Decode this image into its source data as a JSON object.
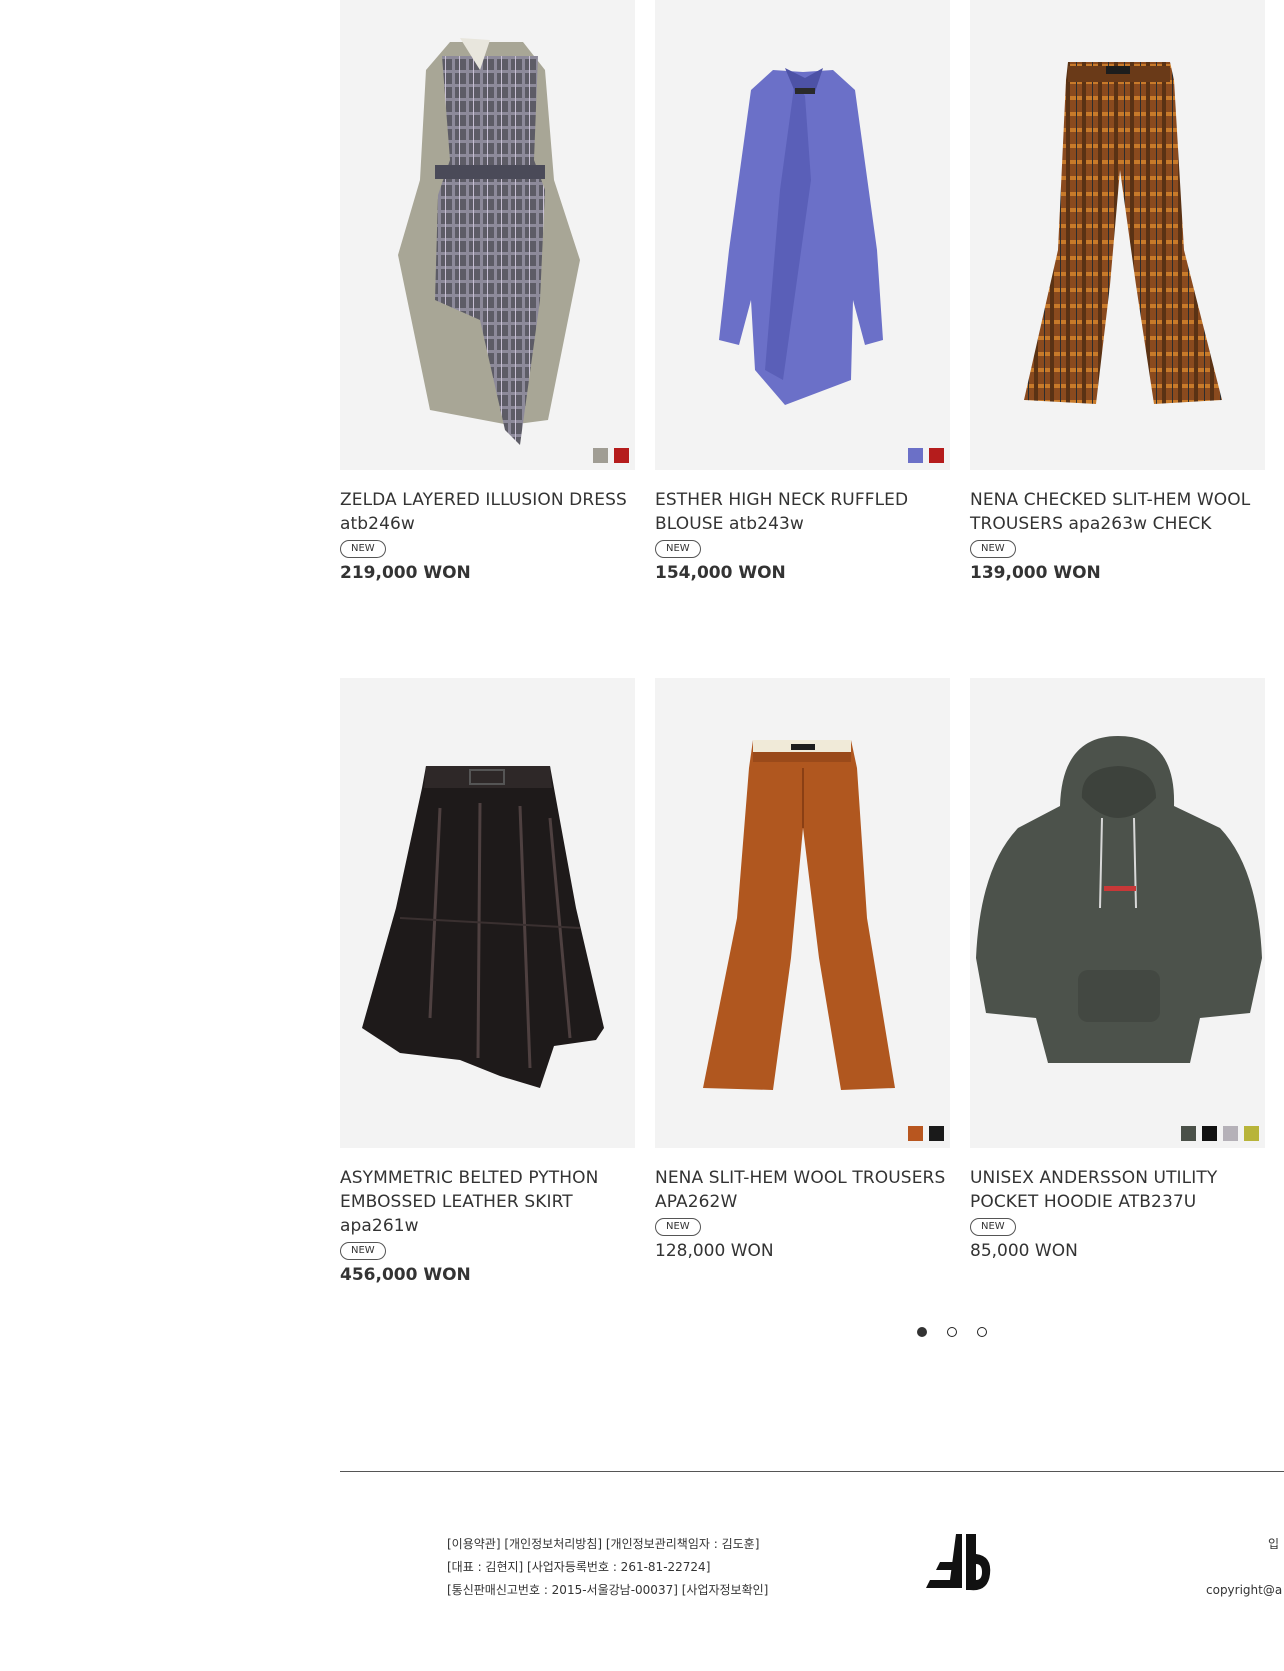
{
  "products": [
    {
      "title": "ZELDA LAYERED ILLUSION DRESS atb246w",
      "badge": "NEW",
      "price": "219,000 WON",
      "price_bold": true,
      "image_icon": "dress-image",
      "swatches": [
        "#a09d94",
        "#b51c1c"
      ]
    },
    {
      "title": "ESTHER HIGH NECK RUFFLED BLOUSE atb243w",
      "badge": "NEW",
      "price": "154,000 WON",
      "price_bold": true,
      "image_icon": "blouse-image",
      "swatches": [
        "#6b70c7",
        "#b51c1c"
      ]
    },
    {
      "title": "NENA CHECKED SLIT-HEM WOOL TROUSERS apa263w CHECK",
      "badge": "NEW",
      "price": "139,000 WON",
      "price_bold": true,
      "image_icon": "trousers-image",
      "swatches": []
    },
    {
      "title": "ASYMMETRIC BELTED PYTHON EMBOSSED LEATHER SKIRT apa261w",
      "badge": "NEW",
      "price": "456,000 WON",
      "price_bold": true,
      "image_icon": "skirt-image",
      "swatches": []
    },
    {
      "title": "NENA SLIT-HEM WOOL TROUSERS APA262W",
      "badge": "NEW",
      "price": "128,000 WON",
      "price_bold": false,
      "image_icon": "trousers-image",
      "swatches": [
        "#b8561f",
        "#1a1a1a"
      ]
    },
    {
      "title": "UNISEX ANDERSSON UTILITY POCKET HOODIE ATB237U",
      "badge": "NEW",
      "price": "85,000 WON",
      "price_bold": false,
      "image_icon": "hoodie-image",
      "swatches": [
        "#4a5048",
        "#111111",
        "#b5b1b8",
        "#b8b43a"
      ]
    }
  ],
  "pagination": {
    "pages": 3,
    "active": 1
  },
  "footer": {
    "line1": [
      "[이용약관]",
      "[개인정보처리방침]",
      "[개인정보관리책임자 : 김도훈]"
    ],
    "line2": "[대표 : 김현지] [사업자등록번호 : 261-81-22724]",
    "line3a": "[통신판매신고번호 : 2015-서울강남-00037]",
    "line3b": "[사업자정보확인]",
    "right1": "입",
    "right2": "copyright@a",
    "logo": "AB"
  }
}
